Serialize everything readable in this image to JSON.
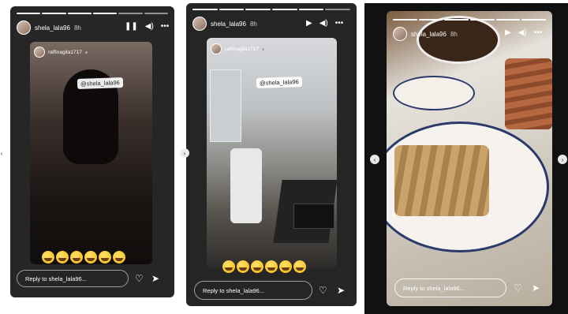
{
  "stories": [
    {
      "username": "shela_lala96",
      "time": "8h",
      "inner_username": "raffinagita1717",
      "tag": "@shela_lala96",
      "reply_placeholder": "Reply to shela_lala96...",
      "emojis": [
        "🤣",
        "🤣",
        "🤣",
        "🤣",
        "🤣",
        "🤣"
      ]
    },
    {
      "username": "shela_lala96",
      "time": "8h",
      "inner_username": "raffinagita1717",
      "tag": "@shela_lala96",
      "reply_placeholder": "Reply to shela_lala96...",
      "emojis": [
        "🤣",
        "🤣",
        "🤣",
        "🤣",
        "🤣",
        "🤣"
      ]
    },
    {
      "username": "shela_lala96",
      "time": "8h",
      "reply_placeholder": "Reply to shela_lala96..."
    }
  ],
  "icons": {
    "pause": "pause-icon",
    "play": "play-icon",
    "sound": "sound-icon",
    "more": "more-icon",
    "like": "heart-icon",
    "share": "send-icon"
  }
}
